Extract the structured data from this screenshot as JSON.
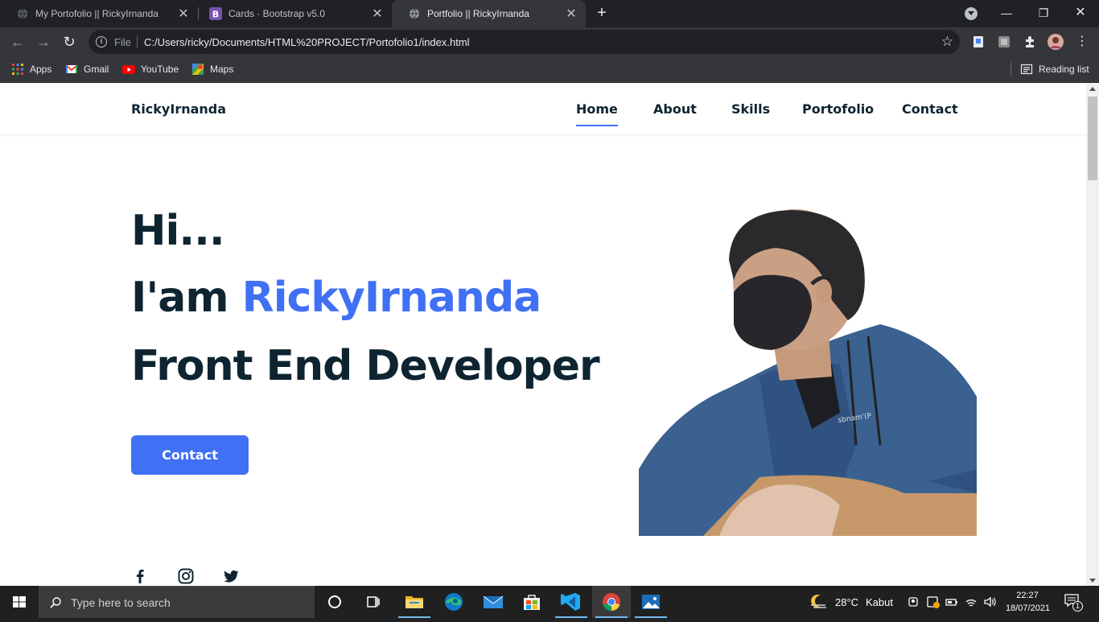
{
  "browser": {
    "tabs": [
      {
        "title": "My Portofolio || RickyIrnanda",
        "active": false
      },
      {
        "title": "Cards · Bootstrap v5.0",
        "active": false
      },
      {
        "title": "Portfolio || RickyIrnanda",
        "active": true
      }
    ],
    "address": {
      "scheme_label": "File",
      "url": "C:/Users/ricky/Documents/HTML%20PROJECT/Portofolio1/index.html"
    },
    "bookmarks": [
      {
        "label": "Apps",
        "icon": "apps-grid-icon"
      },
      {
        "label": "Gmail",
        "icon": "gmail-icon"
      },
      {
        "label": "YouTube",
        "icon": "youtube-icon"
      },
      {
        "label": "Maps",
        "icon": "maps-icon"
      }
    ],
    "reading_list": "Reading list"
  },
  "site": {
    "brand": "RickyIrnanda",
    "nav": [
      {
        "label": "Home",
        "active": true
      },
      {
        "label": "About",
        "active": false
      },
      {
        "label": "Skills",
        "active": false
      },
      {
        "label": "Portofolio",
        "active": false
      },
      {
        "label": "Contact",
        "active": false
      }
    ],
    "hero": {
      "line1": "Hi...",
      "line2_prefix": "I'am ",
      "line2_name": "RickyIrnanda",
      "line3": "Front End Developer",
      "cta_label": "Contact"
    },
    "social": [
      "facebook-icon",
      "instagram-icon",
      "twitter-icon"
    ],
    "colors": {
      "accent": "#4070f4",
      "text": "#0e2431"
    }
  },
  "taskbar": {
    "search_placeholder": "Type here to search",
    "weather": {
      "temp": "28°C",
      "condition": "Kabut"
    },
    "time": "22:27",
    "date": "18/07/2021",
    "notification_count": "1"
  }
}
